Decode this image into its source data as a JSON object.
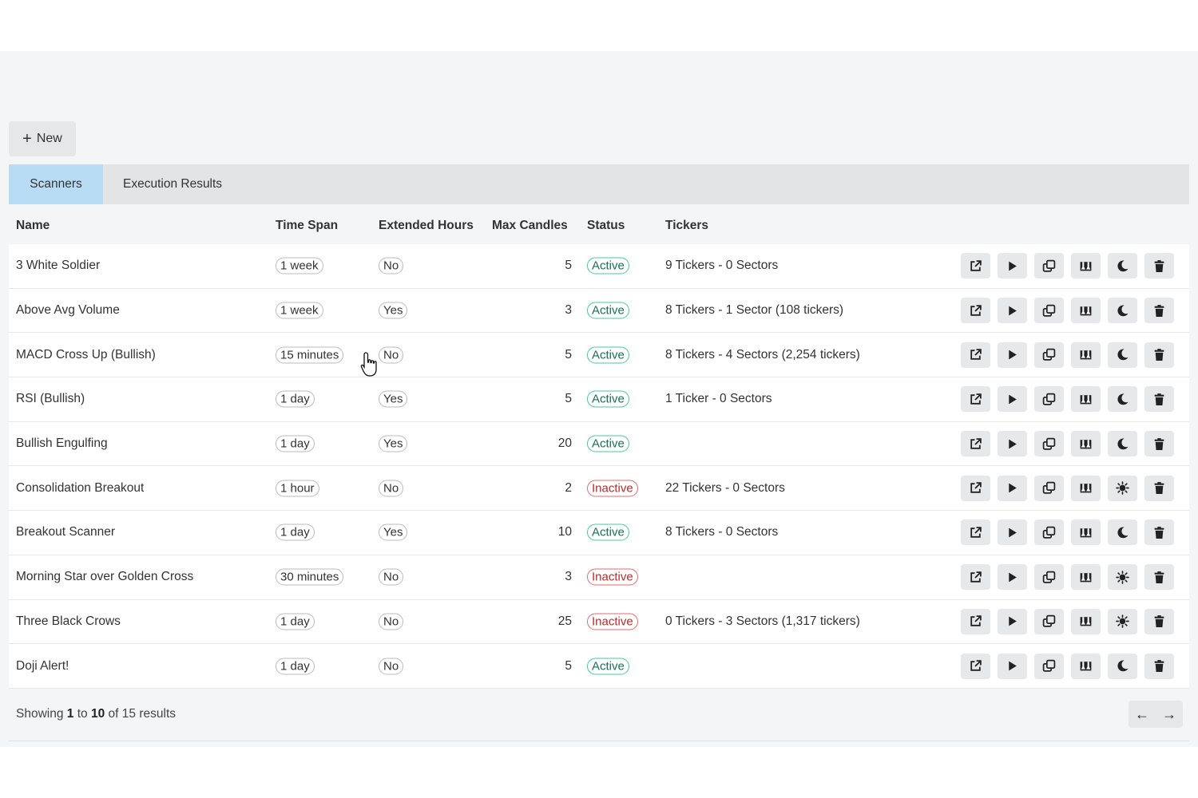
{
  "toolbar": {
    "new_label": "New",
    "new_icon": "plus-icon"
  },
  "tabs": [
    {
      "label": "Scanners",
      "active": true
    },
    {
      "label": "Execution Results",
      "active": false
    }
  ],
  "table": {
    "headers": {
      "name": "Name",
      "time_span": "Time Span",
      "extended_hours": "Extended Hours",
      "max_candles": "Max Candles",
      "status": "Status",
      "tickers": "Tickers"
    },
    "rows": [
      {
        "name": "3 White Soldier",
        "time_span": "1 week",
        "extended": "No",
        "max": "5",
        "status": "Active",
        "tickers": "9 Tickers - 0 Sectors",
        "mode_icon": "moon-icon"
      },
      {
        "name": "Above Avg Volume",
        "time_span": "1 week",
        "extended": "Yes",
        "max": "3",
        "status": "Active",
        "tickers": "8 Tickers - 1 Sector (108 tickers)",
        "mode_icon": "moon-icon"
      },
      {
        "name": "MACD Cross Up (Bullish)",
        "time_span": "15 minutes",
        "extended": "No",
        "max": "5",
        "status": "Active",
        "tickers": "8 Tickers - 4 Sectors (2,254 tickers)",
        "mode_icon": "moon-icon"
      },
      {
        "name": "RSI (Bullish)",
        "time_span": "1 day",
        "extended": "Yes",
        "max": "5",
        "status": "Active",
        "tickers": "1 Ticker - 0 Sectors",
        "mode_icon": "moon-icon"
      },
      {
        "name": "Bullish Engulfing",
        "time_span": "1 day",
        "extended": "Yes",
        "max": "20",
        "status": "Active",
        "tickers": "",
        "mode_icon": "moon-icon"
      },
      {
        "name": "Consolidation Breakout",
        "time_span": "1 hour",
        "extended": "No",
        "max": "2",
        "status": "Inactive",
        "tickers": "22 Tickers - 0 Sectors",
        "mode_icon": "sun-icon"
      },
      {
        "name": "Breakout Scanner",
        "time_span": "1 day",
        "extended": "Yes",
        "max": "10",
        "status": "Active",
        "tickers": "8 Tickers - 0 Sectors",
        "mode_icon": "moon-icon"
      },
      {
        "name": "Morning Star over Golden Cross",
        "time_span": "30 minutes",
        "extended": "No",
        "max": "3",
        "status": "Inactive",
        "tickers": "",
        "mode_icon": "sun-icon"
      },
      {
        "name": "Three Black Crows",
        "time_span": "1 day",
        "extended": "No",
        "max": "25",
        "status": "Inactive",
        "tickers": "0 Tickers - 3 Sectors (1,317 tickers)",
        "mode_icon": "sun-icon"
      },
      {
        "name": "Doji Alert!",
        "time_span": "1 day",
        "extended": "No",
        "max": "5",
        "status": "Active",
        "tickers": "",
        "mode_icon": "moon-icon"
      }
    ]
  },
  "footer": {
    "showing": "Showing",
    "from": "1",
    "to_word": "to",
    "to": "10",
    "of_word": "of",
    "total": "15",
    "results_word": "results",
    "prev_icon": "arrow-left-icon",
    "next_icon": "arrow-right-icon"
  },
  "colors": {
    "active_tab": "#b9dcf5",
    "active_status": "#4cc6a0",
    "inactive_status": "#e06c6c"
  }
}
